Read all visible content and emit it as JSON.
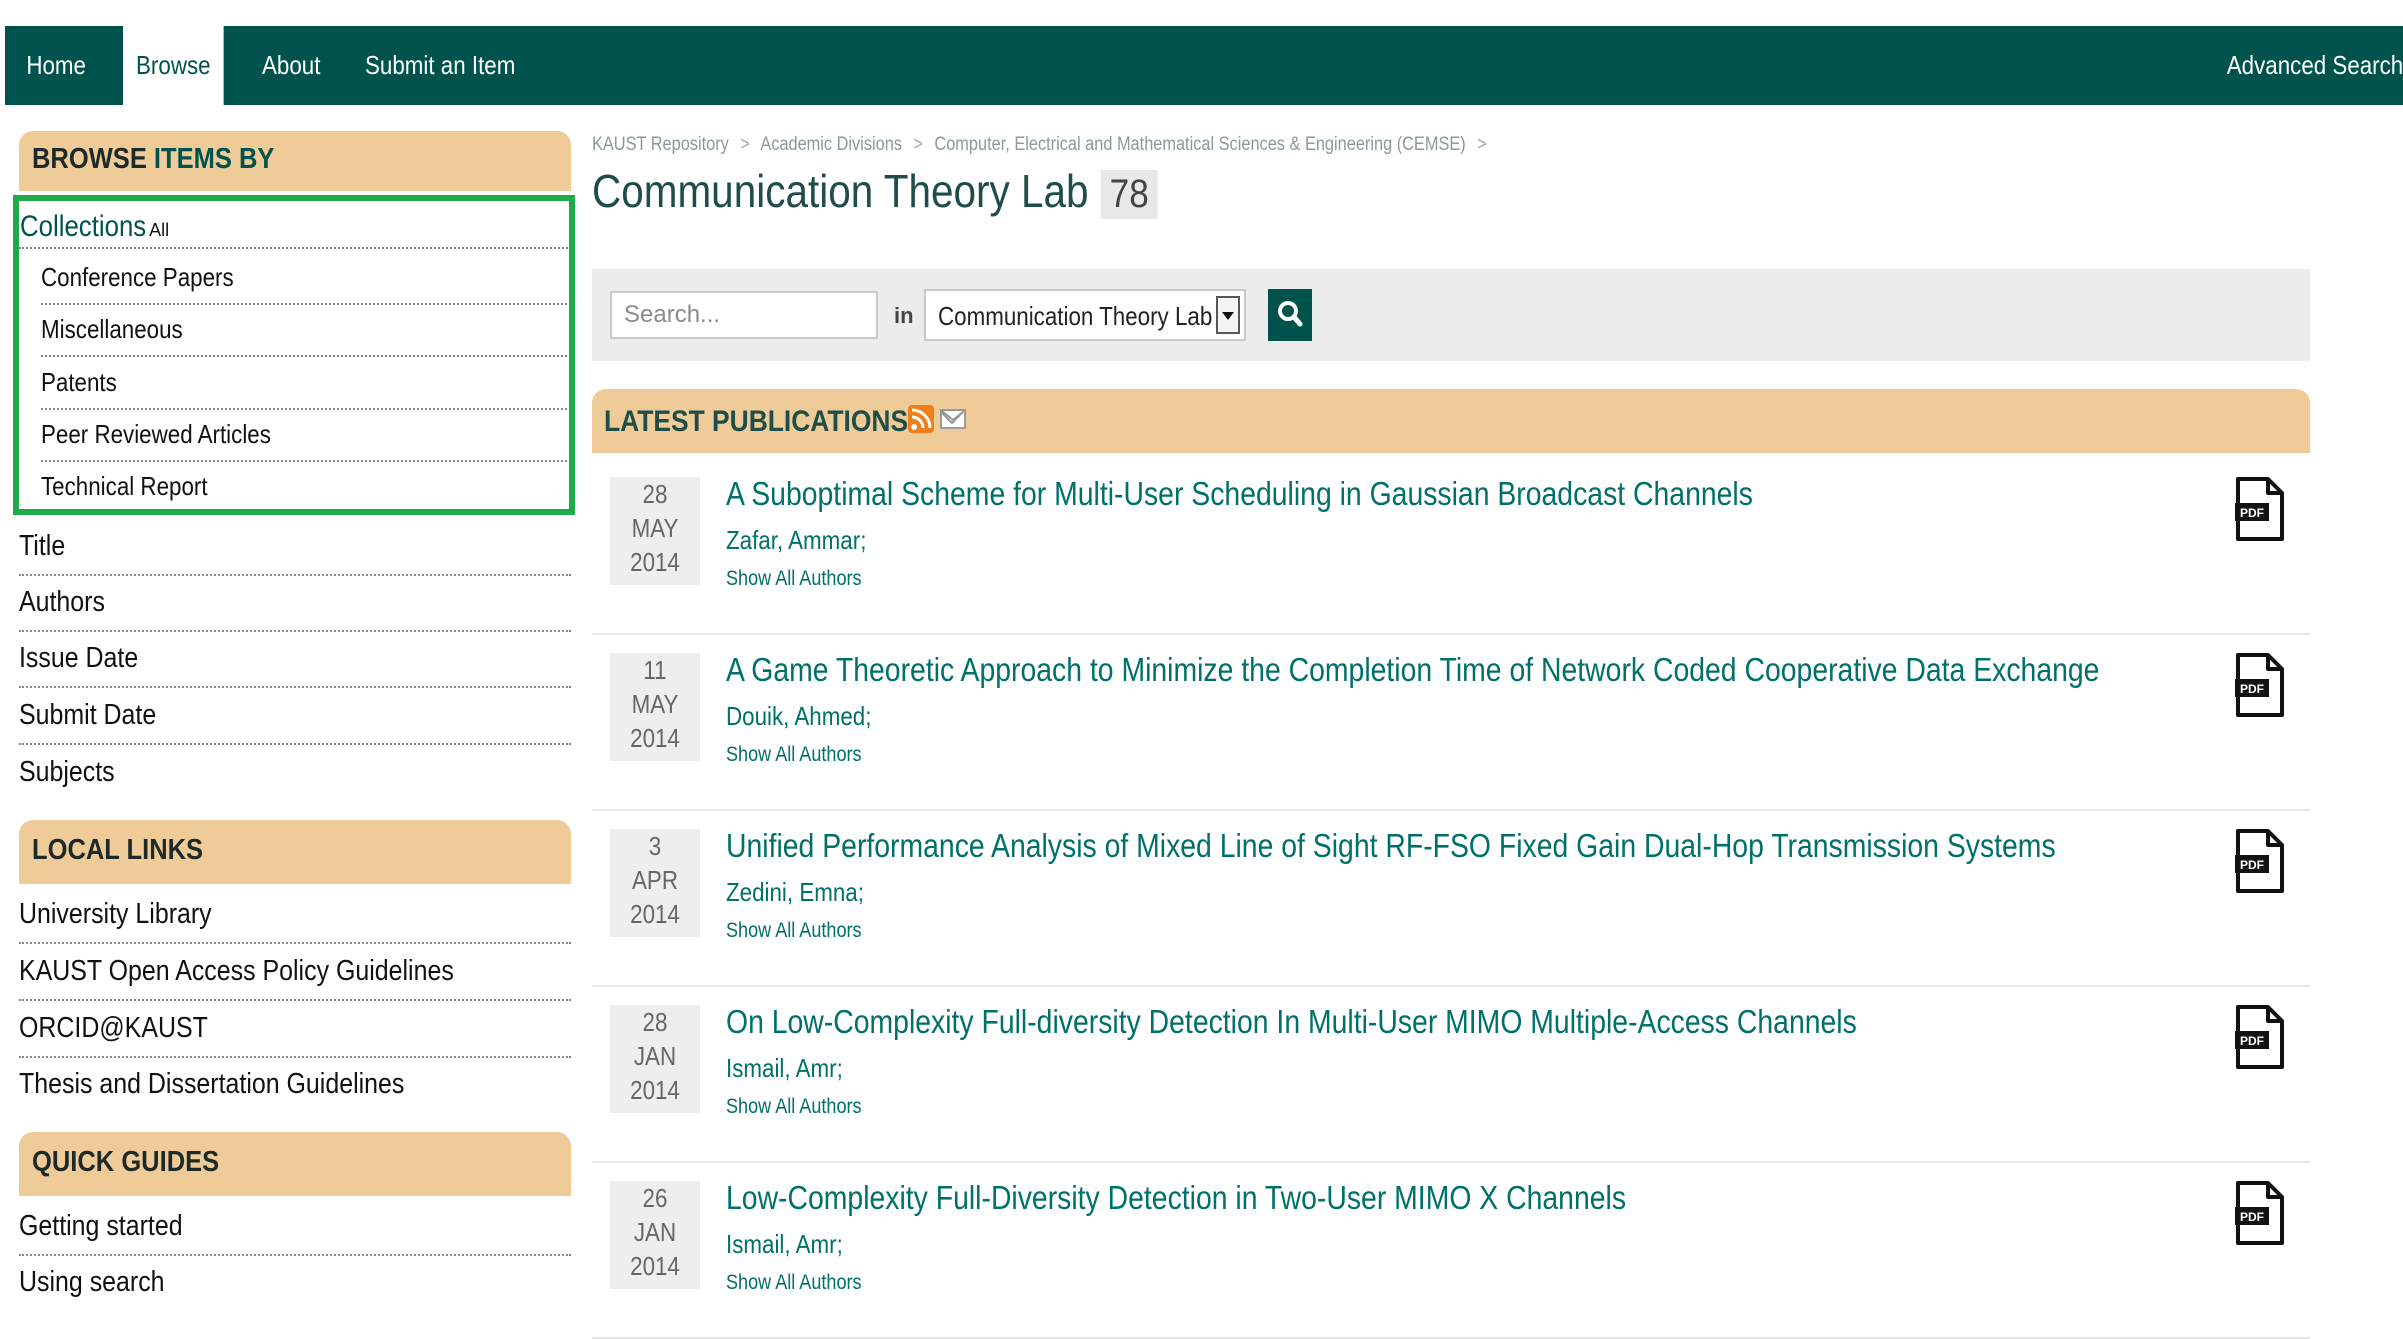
{
  "nav": {
    "items": [
      {
        "label": "Home",
        "active": false
      },
      {
        "label": "Browse",
        "active": true
      },
      {
        "label": "About",
        "active": false
      },
      {
        "label": "Submit an Item",
        "active": false
      }
    ],
    "advanced_search": "Advanced Search"
  },
  "sidebar": {
    "browse_heading_part1": "BROWSE",
    "browse_heading_part2": "ITEMS BY",
    "collections_label": "Collections",
    "collections_all": "All",
    "collections": [
      "Conference Papers",
      "Miscellaneous",
      "Patents",
      "Peer Reviewed Articles",
      "Technical Report"
    ],
    "browse_items": [
      "Title",
      "Authors",
      "Issue Date",
      "Submit Date",
      "Subjects"
    ],
    "local_links_heading": "LOCAL LINKS",
    "local_links": [
      "University Library",
      "KAUST Open Access Policy Guidelines",
      "ORCID@KAUST",
      "Thesis and Dissertation Guidelines"
    ],
    "quick_guides_heading": "QUICK GUIDES",
    "quick_guides": [
      "Getting started",
      "Using search"
    ]
  },
  "breadcrumb": [
    "KAUST Repository",
    "Academic Divisions",
    "Computer, Electrical and Mathematical Sciences & Engineering (CEMSE)"
  ],
  "breadcrumb_sep": ">",
  "page": {
    "title": "Communication Theory Lab",
    "count": "78"
  },
  "search": {
    "placeholder": "Search...",
    "in_label": "in",
    "scope": "Communication Theory Lab"
  },
  "latest": {
    "heading": "LATEST PUBLICATIONS"
  },
  "publications": [
    {
      "day": "28",
      "month": "MAY",
      "year": "2014",
      "title": "A Suboptimal Scheme for Multi-User Scheduling in Gaussian Broadcast Channels",
      "author": "Zafar, Ammar;",
      "show_all": "Show All Authors"
    },
    {
      "day": "11",
      "month": "MAY",
      "year": "2014",
      "title": "A Game Theoretic Approach to Minimize the Completion Time of Network Coded Cooperative Data Exchange",
      "author": "Douik, Ahmed;",
      "show_all": "Show All Authors"
    },
    {
      "day": "3",
      "month": "APR",
      "year": "2014",
      "title": "Unified Performance Analysis of Mixed Line of Sight RF-FSO Fixed Gain Dual-Hop Transmission Systems",
      "author": "Zedini, Emna;",
      "show_all": "Show All Authors"
    },
    {
      "day": "28",
      "month": "JAN",
      "year": "2014",
      "title": "On Low-Complexity Full-diversity Detection In Multi-User MIMO Multiple-Access Channels",
      "author": "Ismail, Amr;",
      "show_all": "Show All Authors"
    },
    {
      "day": "26",
      "month": "JAN",
      "year": "2014",
      "title": "Low-Complexity Full-Diversity Detection in Two-User MIMO X Channels",
      "author": "Ismail, Amr;",
      "show_all": "Show All Authors"
    }
  ],
  "pdf_label": "PDF",
  "colors": {
    "nav": "#00534c",
    "accent_bar": "#efcb98",
    "highlight": "#1fab4a",
    "link": "#00706a"
  }
}
